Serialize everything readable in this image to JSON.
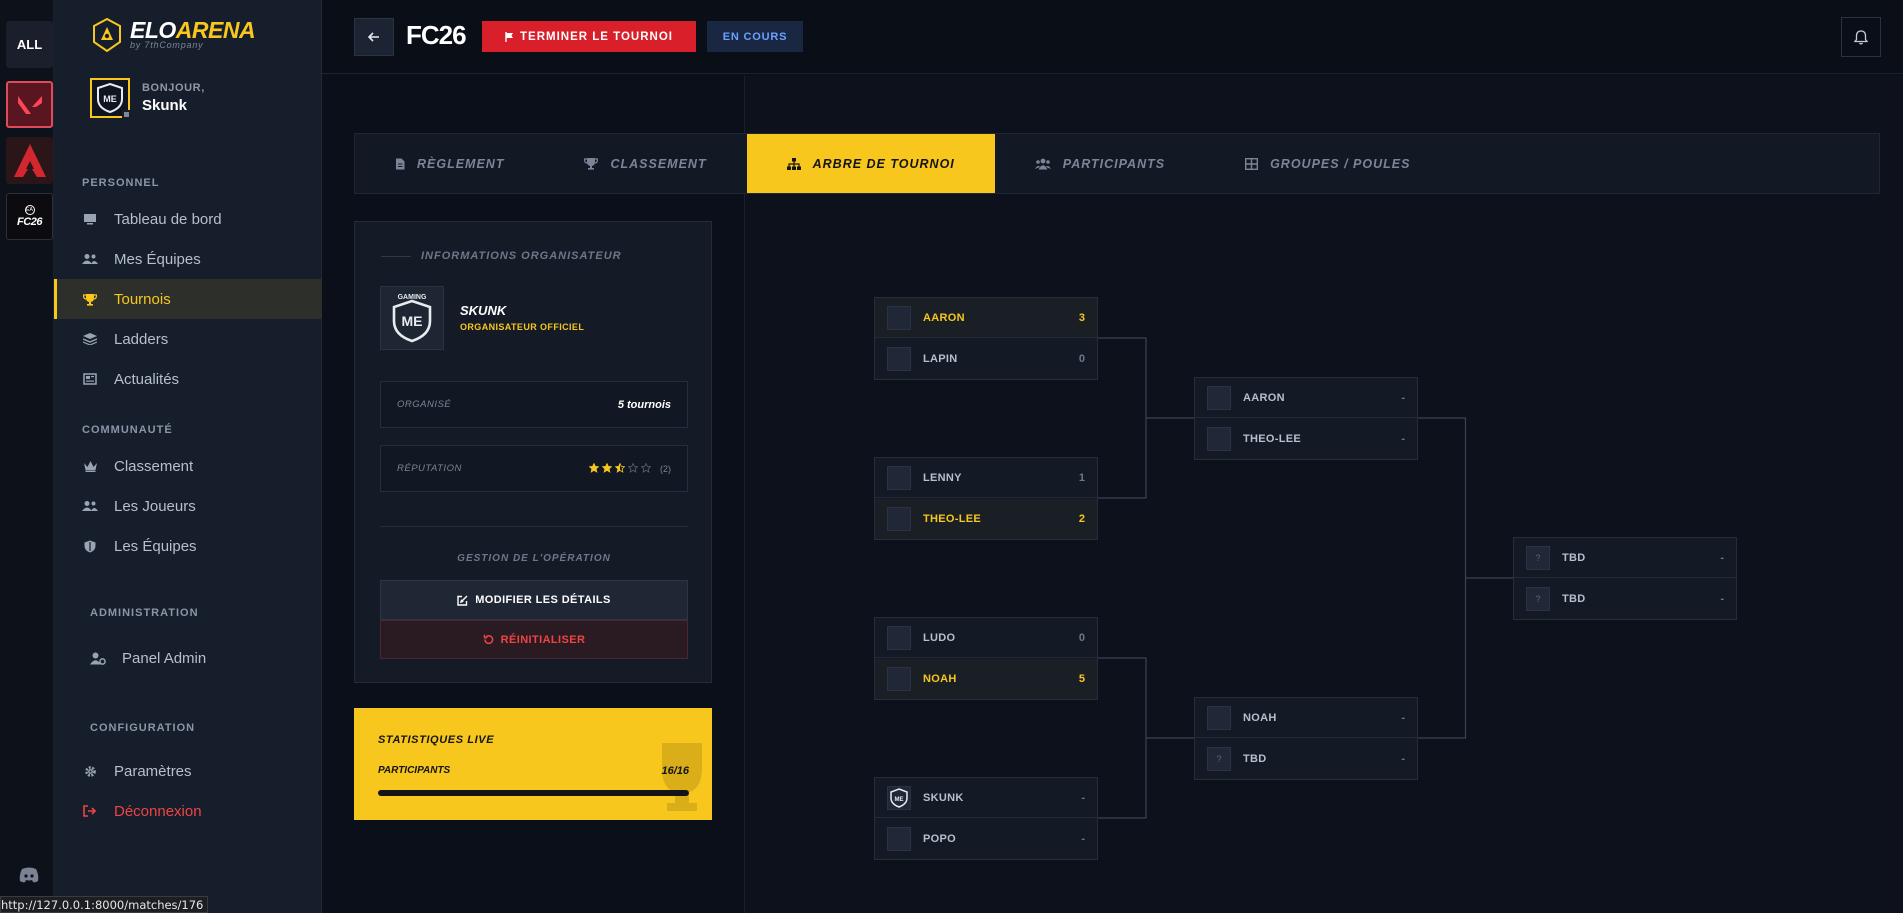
{
  "rail": {
    "all_label": "ALL",
    "fc_label": "FC26"
  },
  "brand": {
    "name_white": "ELO",
    "name_yellow": "ARENA",
    "subtitle": "by 7thCompany"
  },
  "user": {
    "greeting": "BONJOUR,",
    "name": "Skunk"
  },
  "sidebar": {
    "sections": {
      "personnel": "PERSONNEL",
      "communaute": "COMMUNAUTÉ",
      "administration": "ADMINISTRATION",
      "configuration": "CONFIGURATION"
    },
    "items": [
      {
        "label": "Tableau de bord",
        "icon": "monitor-icon"
      },
      {
        "label": "Mes Équipes",
        "icon": "users-icon"
      },
      {
        "label": "Tournois",
        "icon": "trophy-icon",
        "active": true
      },
      {
        "label": "Ladders",
        "icon": "layers-icon"
      },
      {
        "label": "Actualités",
        "icon": "newspaper-icon"
      },
      {
        "label": "Classement",
        "icon": "crown-icon"
      },
      {
        "label": "Les Joueurs",
        "icon": "users-icon"
      },
      {
        "label": "Les Équipes",
        "icon": "shield-icon"
      },
      {
        "label": "Panel Admin",
        "icon": "user-cog-icon"
      },
      {
        "label": "Paramètres",
        "icon": "gear-icon"
      },
      {
        "label": "Déconnexion",
        "icon": "logout-icon",
        "danger": true
      }
    ]
  },
  "topbar": {
    "title": "FC26",
    "end_button": "TERMINER LE TOURNOI",
    "status": "EN COURS"
  },
  "tabs": [
    {
      "label": "RÈGLEMENT",
      "icon": "file-icon"
    },
    {
      "label": "CLASSEMENT",
      "icon": "trophy-icon"
    },
    {
      "label": "ARBRE DE TOURNOI",
      "icon": "sitemap-icon",
      "active": true
    },
    {
      "label": "PARTICIPANTS",
      "icon": "users-icon"
    },
    {
      "label": "GROUPES / POULES",
      "icon": "grid-icon"
    }
  ],
  "organizer": {
    "header": "INFORMATIONS ORGANISATEUR",
    "name": "SKUNK",
    "role": "ORGANISATEUR OFFICIEL",
    "organized_label": "ORGANISÉ",
    "organized_value": "5 tournois",
    "reputation_label": "RÉPUTATION",
    "reputation_stars": 2.5,
    "reputation_count": "(2)",
    "ops_title": "GESTION DE L'OPÉRATION",
    "edit_button": "MODIFIER LES DÉTAILS",
    "reset_button": "RÉINITIALISER"
  },
  "stats": {
    "title": "STATISTIQUES LIVE",
    "participants_label": "PARTICIPANTS",
    "participants_value": "16/16",
    "participants_fraction": 1.0
  },
  "bracket": {
    "round1": [
      {
        "a": {
          "name": "AARON",
          "score": "3",
          "win": true
        },
        "b": {
          "name": "LAPIN",
          "score": "0"
        }
      },
      {
        "a": {
          "name": "LENNY",
          "score": "1"
        },
        "b": {
          "name": "THEO-LEE",
          "score": "2",
          "win": true
        }
      },
      {
        "a": {
          "name": "LUDO",
          "score": "0"
        },
        "b": {
          "name": "NOAH",
          "score": "5",
          "win": true
        }
      },
      {
        "a": {
          "name": "SKUNK",
          "score": "-",
          "has_logo": true
        },
        "b": {
          "name": "POPO",
          "score": "-"
        }
      }
    ],
    "round2": [
      {
        "a": {
          "name": "AARON",
          "score": "-"
        },
        "b": {
          "name": "THEO-LEE",
          "score": "-"
        }
      },
      {
        "a": {
          "name": "NOAH",
          "score": "-"
        },
        "b": {
          "name": "TBD",
          "score": "-",
          "unknown": true
        }
      }
    ],
    "final": [
      {
        "a": {
          "name": "TBD",
          "score": "-",
          "unknown": true
        },
        "b": {
          "name": "TBD",
          "score": "-",
          "unknown": true
        }
      }
    ],
    "unknown_mark": "?"
  },
  "status_url": "http://127.0.0.1:8000/matches/176",
  "colors": {
    "accent": "#f8c71d",
    "danger": "#d81f2a",
    "background": "#0b0f19"
  }
}
